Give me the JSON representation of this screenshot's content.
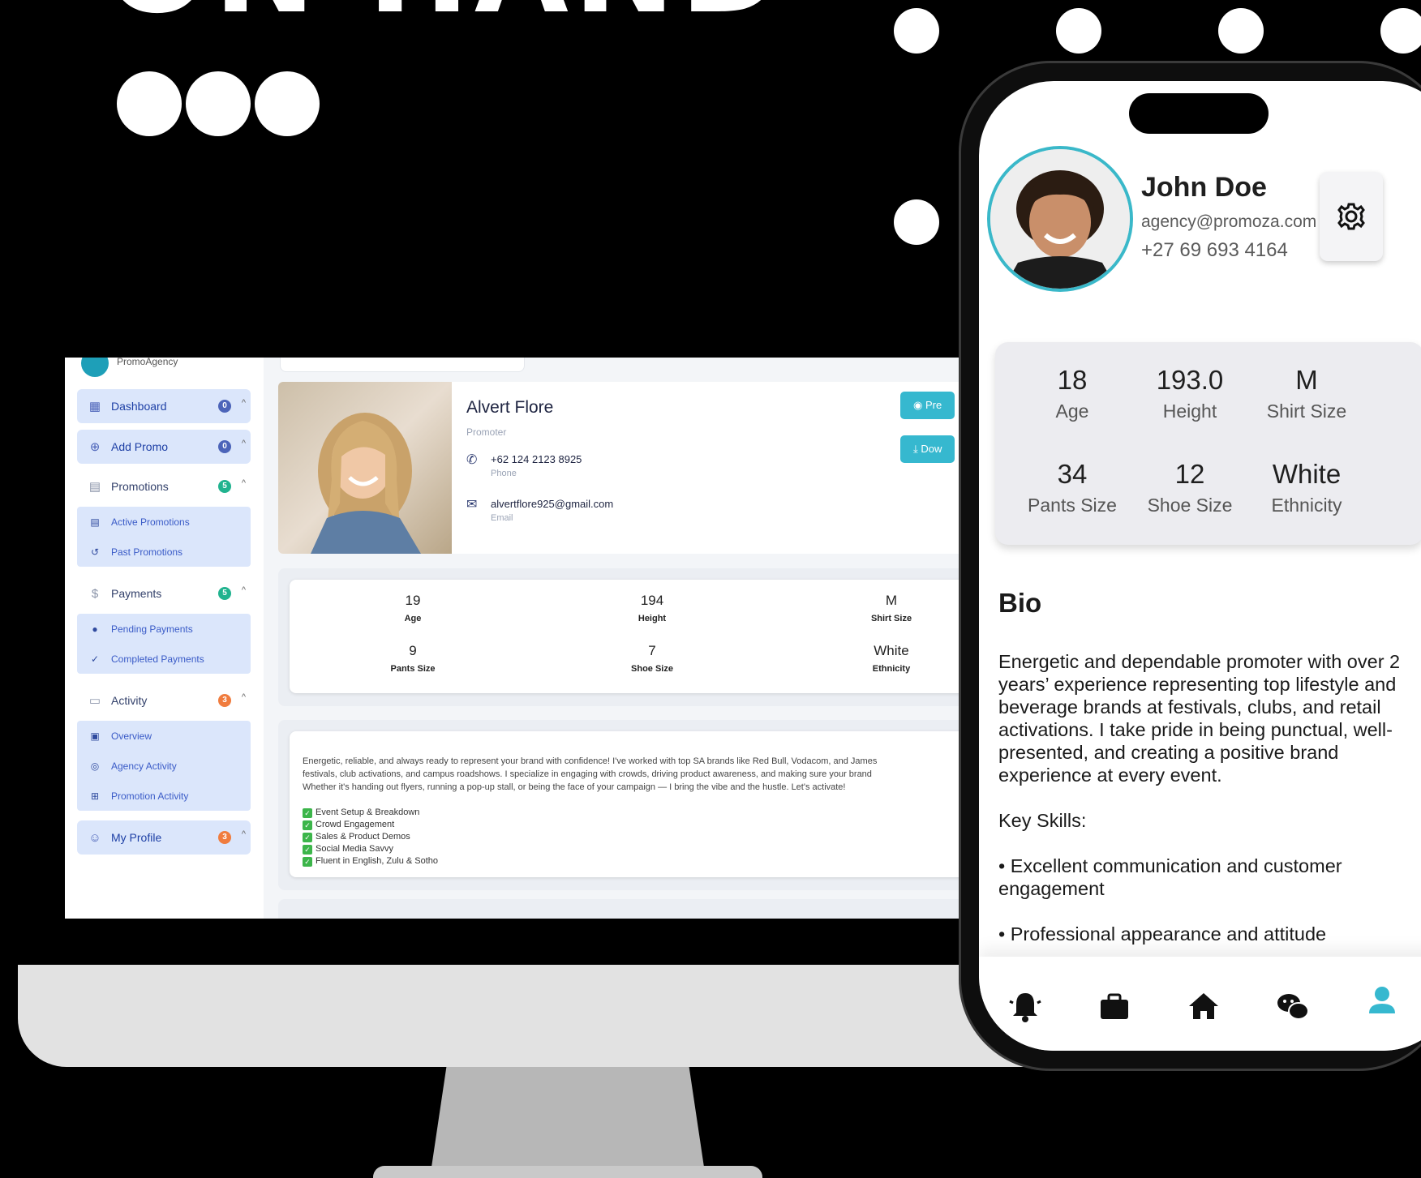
{
  "colors": {
    "accent_teal": "#36b8cf",
    "nav_active_bg": "#dbe6fb",
    "badge_blue": "#4c64b9",
    "badge_green": "#21b38f",
    "badge_orange": "#f07c3e"
  },
  "desktop": {
    "sidebar": {
      "logo_text": "PromoAgency",
      "items": [
        {
          "label": "Dashboard",
          "badge": "0",
          "icon": "grid-icon"
        },
        {
          "label": "Add Promo",
          "badge": "0",
          "icon": "plus-circle-icon"
        },
        {
          "label": "Promotions",
          "badge": "5",
          "icon": "clipboard-icon"
        },
        {
          "label": "Payments",
          "badge": "5",
          "icon": "dollar-icon"
        },
        {
          "label": "Activity",
          "badge": "3",
          "icon": "chat-icon"
        },
        {
          "label": "My Profile",
          "badge": "3",
          "icon": "user-icon"
        }
      ],
      "promotions_sub": [
        "Active Promotions",
        "Past Promotions"
      ],
      "payments_sub": [
        "Pending Payments",
        "Completed Payments"
      ],
      "activity_sub": [
        "Overview",
        "Agency Activity",
        "Promotion Activity"
      ]
    },
    "profile": {
      "name": "Alvert Flore",
      "role": "Promoter",
      "phone": "+62 124 2123 8925",
      "phone_caption": "Phone",
      "email": "alvertflore925@gmail.com",
      "email_caption": "Email",
      "preview_button": "Pre",
      "download_button": "Dow"
    },
    "stats": [
      {
        "value": "19",
        "label": "Age"
      },
      {
        "value": "194",
        "label": "Height"
      },
      {
        "value": "M",
        "label": "Shirt Size"
      },
      {
        "value": "9",
        "label": "Pants Size"
      },
      {
        "value": "7",
        "label": "Shoe Size"
      },
      {
        "value": "White",
        "label": "Ethnicity"
      }
    ],
    "bio_lines": [
      "Energetic, reliable, and always ready to represent your brand with confidence! I've worked with top SA brands like Red Bull, Vodacom, and James",
      "festivals, club activations, and campus roadshows. I specialize in engaging with crowds, driving product awareness, and making sure your brand",
      "Whether it's handing out flyers, running a pop-up stall, or being the face of your campaign — I bring the vibe and the hustle. Let's activate!"
    ],
    "skills": [
      "Event Setup & Breakdown",
      "Crowd Engagement",
      "Sales & Product Demos",
      "Social Media Savvy",
      "Fluent in English, Zulu & Sotho"
    ]
  },
  "phone": {
    "name": "John Doe",
    "email": "agency@promoza.com",
    "phone": "+27 69 693 4164",
    "stats": [
      {
        "value": "18",
        "label": "Age"
      },
      {
        "value": "193.0",
        "label": "Height"
      },
      {
        "value": "M",
        "label": "Shirt Size"
      },
      {
        "value": "34",
        "label": "Pants Size"
      },
      {
        "value": "12",
        "label": "Shoe Size"
      },
      {
        "value": "White",
        "label": "Ethnicity"
      }
    ],
    "bio_title": "Bio",
    "bio_paragraph": "Energetic and dependable promoter with over 2 years’ experience representing top lifestyle and beverage brands at festivals, clubs, and retail activations. I take pride in being punctual, well-presented, and creating a positive brand experience at every event.",
    "skills_title": "Key Skills:",
    "skills": [
      "• Excellent communication and customer engagement",
      "• Professional appearance and attitude"
    ],
    "tabs": [
      "bell-icon",
      "briefcase-icon",
      "home-icon",
      "chat-bubbles-icon",
      "user-icon"
    ]
  }
}
